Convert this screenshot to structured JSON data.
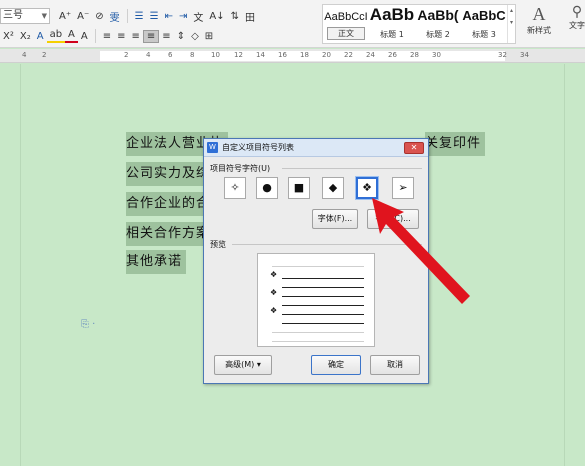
{
  "ribbon": {
    "font_size_value": "三号",
    "row1": [
      "A⁺",
      "A⁻",
      "⊘",
      "雯",
      "☰",
      "☰",
      "⇤",
      "⇥",
      "文",
      "A↓",
      "⇅",
      "田"
    ],
    "row2": [
      "X²",
      "X₂",
      "A",
      "ab",
      "A",
      "A"
    ],
    "styles": [
      {
        "preview": "AaBbCcI",
        "caption": "正文"
      },
      {
        "preview": "AaBb",
        "caption": "标题 1"
      },
      {
        "preview": "AaBb(",
        "caption": "标题 2"
      },
      {
        "preview": "AaBbC",
        "caption": "标题 3"
      }
    ],
    "new_style_label": "新样式",
    "text_tools_label": "文字"
  },
  "ruler": {
    "ticks": [
      "4",
      "2",
      "2",
      "4",
      "6",
      "8",
      "10",
      "12",
      "14",
      "16",
      "18",
      "20",
      "22",
      "24",
      "26",
      "28",
      "30",
      "32",
      "34"
    ]
  },
  "document": {
    "lines": [
      {
        "left": "企业法人营业执",
        "right": "关复印件"
      },
      {
        "left": "公司实力及综合"
      },
      {
        "left": "合作企业的合同"
      },
      {
        "left": "相关合作方案"
      },
      {
        "left": "其他承诺"
      }
    ]
  },
  "dialog": {
    "title": "自定义项目符号列表",
    "close_label": "✕",
    "group_label": "项目符号字符(U)",
    "bullets": [
      "✧",
      "●",
      "■",
      "◆",
      "❖",
      "➢"
    ],
    "selected_bullet_index": 4,
    "font_button": "字体(F)...",
    "char_button": "字符(C)...",
    "preview_label": "预览",
    "preview_bullet": "❖",
    "advanced_button": "高级(M) ▾",
    "ok_button": "确定",
    "cancel_button": "取消"
  },
  "colors": {
    "page_background": "#c8e8c8",
    "selection_highlight": "#9ec29e",
    "annotation_arrow": "#e0141e",
    "selected_border": "#2f6fd6"
  }
}
